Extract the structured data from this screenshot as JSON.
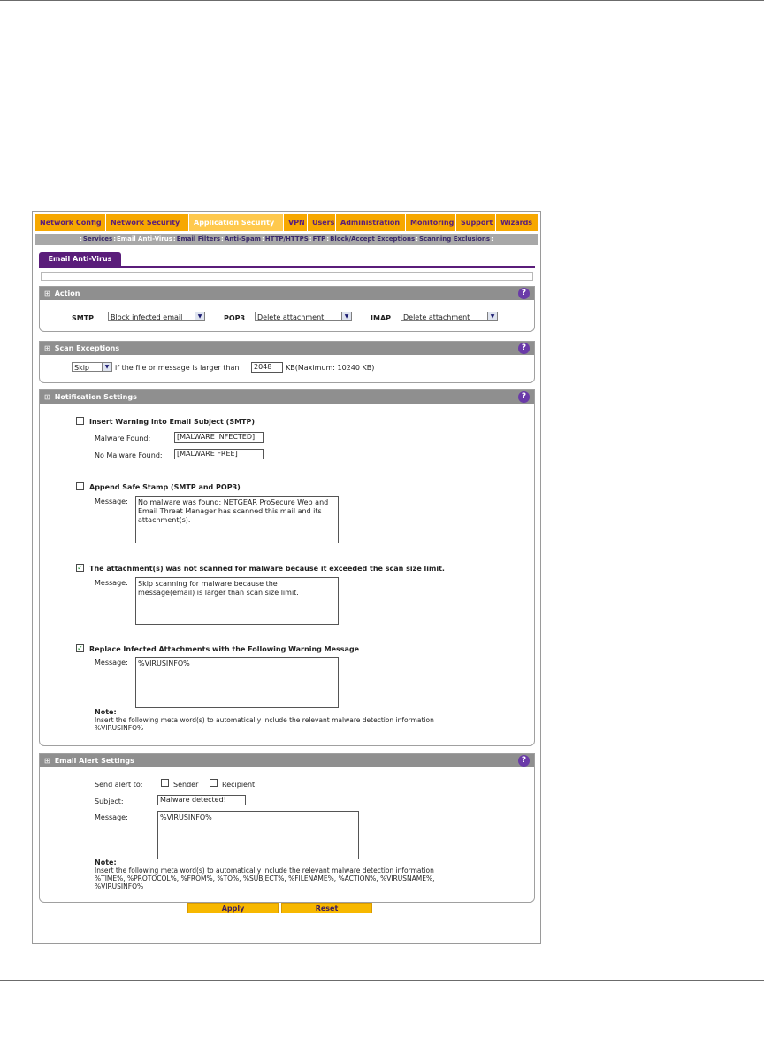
{
  "nav": {
    "tabs": [
      "Network Config",
      "Network Security",
      "Application Security",
      "VPN",
      "Users",
      "Administration",
      "Monitoring",
      "Support",
      "Wizards"
    ],
    "subnav": [
      "Services",
      "Email Anti-Virus",
      "Email Filters",
      "Anti-Spam",
      "HTTP/HTTPS",
      "FTP",
      "Block/Accept Exceptions",
      "Scanning Exclusions"
    ]
  },
  "page_tab": "Email Anti-Virus",
  "action": {
    "title": "Action",
    "smtp_label": "SMTP",
    "smtp_value": "Block infected email",
    "pop3_label": "POP3",
    "pop3_value": "Delete attachment",
    "imap_label": "IMAP",
    "imap_value": "Delete attachment"
  },
  "scan_exceptions": {
    "title": "Scan Exceptions",
    "mode": "Skip",
    "text": "if the file or message is larger than",
    "size": "2048",
    "suffix": "KB(Maximum: 10240 KB)"
  },
  "notification": {
    "title": "Notification Settings",
    "insert_warning": {
      "label": "Insert Warning into Email Subject (SMTP)",
      "checked": "",
      "malware_found_label": "Malware Found:",
      "malware_found_value": "[MALWARE INFECTED]",
      "no_malware_label": "No Malware Found:",
      "no_malware_value": "[MALWARE FREE]"
    },
    "safe_stamp": {
      "label": "Append Safe Stamp (SMTP and POP3)",
      "checked": "",
      "message_label": "Message:",
      "message": "No malware was found: NETGEAR ProSecure Web and Email Threat Manager has scanned this mail and its attachment(s)."
    },
    "not_scanned": {
      "label": "The attachment(s) was not scanned for malware because it exceeded the scan size limit.",
      "checked": "✓",
      "message_label": "Message:",
      "message": "Skip scanning for malware because the message(email) is larger than scan size limit."
    },
    "replace_infected": {
      "label": "Replace Infected Attachments with the Following Warning Message",
      "checked": "✓",
      "message_label": "Message:",
      "message": "%VIRUSINFO%"
    },
    "note_title": "Note:",
    "note_text": "Insert the following meta word(s) to automatically include the relevant malware detection information",
    "note_words": "%VIRUSINFO%"
  },
  "alert": {
    "title": "Email Alert Settings",
    "send_label": "Send alert to:",
    "sender_label": "Sender",
    "recipient_label": "Recipient",
    "subject_label": "Subject:",
    "subject_value": "Malware detected!",
    "message_label": "Message:",
    "message": "%VIRUSINFO%",
    "note_title": "Note:",
    "note_text": "Insert the following meta word(s) to automatically include the relevant malware detection information",
    "note_words": "%TIME%, %PROTOCOL%, %FROM%, %TO%, %SUBJECT%, %FILENAME%, %ACTION%, %VIRUSNAME%, %VIRUSINFO%"
  },
  "buttons": {
    "apply": "Apply",
    "reset": "Reset"
  },
  "help_glyph": "?",
  "icons": {
    "help": "help-icon",
    "expand": "section-expand-icon",
    "dropdown": "chevron-down-icon",
    "check": "checkmark-icon"
  }
}
